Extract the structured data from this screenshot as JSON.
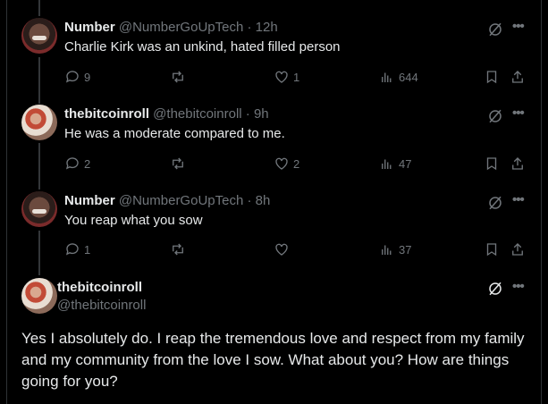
{
  "replies": [
    {
      "name": "Number",
      "handle": "@NumberGoUpTech",
      "time": "· 12h",
      "text": "Charlie Kirk was an unkind, hated filled person",
      "replies_count": "9",
      "reposts_count": "",
      "likes_count": "1",
      "views_count": "644",
      "avatar_icon": "profile-photo-icon"
    },
    {
      "name": "thebitcoinroll",
      "handle": "@thebitcoinroll",
      "time": "· 9h",
      "text": "He was a moderate compared to me.",
      "replies_count": "2",
      "reposts_count": "",
      "likes_count": "2",
      "views_count": "47",
      "avatar_icon": "profile-photo-icon"
    },
    {
      "name": "Number",
      "handle": "@NumberGoUpTech",
      "time": "· 8h",
      "text": "You reap what you sow",
      "replies_count": "1",
      "reposts_count": "",
      "likes_count": "",
      "views_count": "37",
      "avatar_icon": "profile-photo-icon"
    }
  ],
  "main_post": {
    "name": "thebitcoinroll",
    "handle": "@thebitcoinroll",
    "text": "Yes I absolutely do. I reap the tremendous love and respect from my family and my community from the love I sow. What about you? How are things going for you?"
  },
  "colors": {
    "background": "#000000",
    "text_primary": "#e7e9ea",
    "text_secondary": "#71767b",
    "divider": "#2f3336"
  },
  "icons": [
    "reply-icon",
    "repost-icon",
    "like-icon",
    "views-icon",
    "bookmark-icon",
    "share-icon",
    "grok-icon",
    "more-icon"
  ]
}
